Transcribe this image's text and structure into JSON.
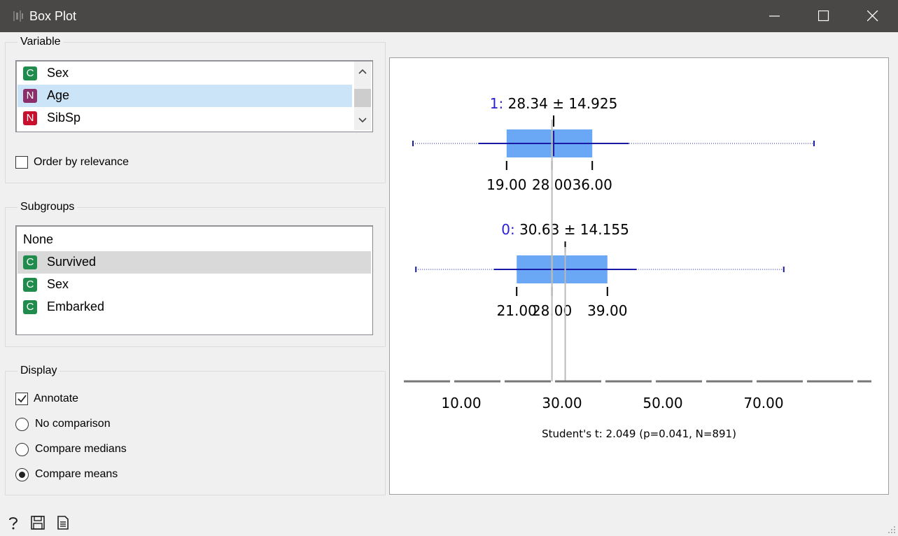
{
  "window": {
    "title": "Box Plot"
  },
  "variable": {
    "group_title": "Variable",
    "items": [
      {
        "badge": "C",
        "label": "Sex",
        "badge_color": "#1f8b4c"
      },
      {
        "badge": "N",
        "label": "Age",
        "badge_color": "#8b2e6b"
      },
      {
        "badge": "N",
        "label": "SibSp",
        "badge_color": "#c8102e"
      }
    ],
    "selected_index": 1,
    "order_by_relevance_label": "Order by relevance",
    "order_by_relevance_checked": false
  },
  "subgroups": {
    "group_title": "Subgroups",
    "items": [
      {
        "badge": "",
        "label": "None"
      },
      {
        "badge": "C",
        "label": "Survived",
        "badge_color": "#1f8b4c"
      },
      {
        "badge": "C",
        "label": "Sex",
        "badge_color": "#1f8b4c"
      },
      {
        "badge": "C",
        "label": "Embarked",
        "badge_color": "#1f8b4c"
      }
    ],
    "selected_index": 1
  },
  "display": {
    "group_title": "Display",
    "annotate_label": "Annotate",
    "annotate_checked": true,
    "options": [
      "No comparison",
      "Compare medians",
      "Compare means"
    ],
    "selected_option": 2
  },
  "chart_data": {
    "type": "boxplot",
    "orientation": "horizontal",
    "x_ticks": [
      "10.00",
      "30.00",
      "50.00",
      "70.00"
    ],
    "xlim": [
      0.42,
      80.0
    ],
    "groups": [
      {
        "name": "1",
        "mean": 28.34,
        "sd": 14.925,
        "mean_label": "28.34 ± 14.925",
        "min": 0.42,
        "q1": 19.0,
        "median": 28.0,
        "q3": 36.0,
        "max": 80.0,
        "q1_label": "19.00",
        "median_label": "28.00",
        "q3_label": "36.00"
      },
      {
        "name": "0",
        "mean": 30.63,
        "sd": 14.155,
        "mean_label": "30.63 ± 14.155",
        "min": 1.0,
        "q1": 21.0,
        "median": 28.0,
        "q3": 39.0,
        "max": 74.0,
        "q1_label": "21.00",
        "median_label": "28.00",
        "q3_label": "39.00"
      }
    ],
    "footer": "Student's t: 2.049 (p=0.041, N=891)",
    "colors": {
      "box": "#6aa8f5",
      "whisker": "#1a1aa8",
      "median": "#f0f028",
      "group_label": "#2a1fd6"
    }
  }
}
